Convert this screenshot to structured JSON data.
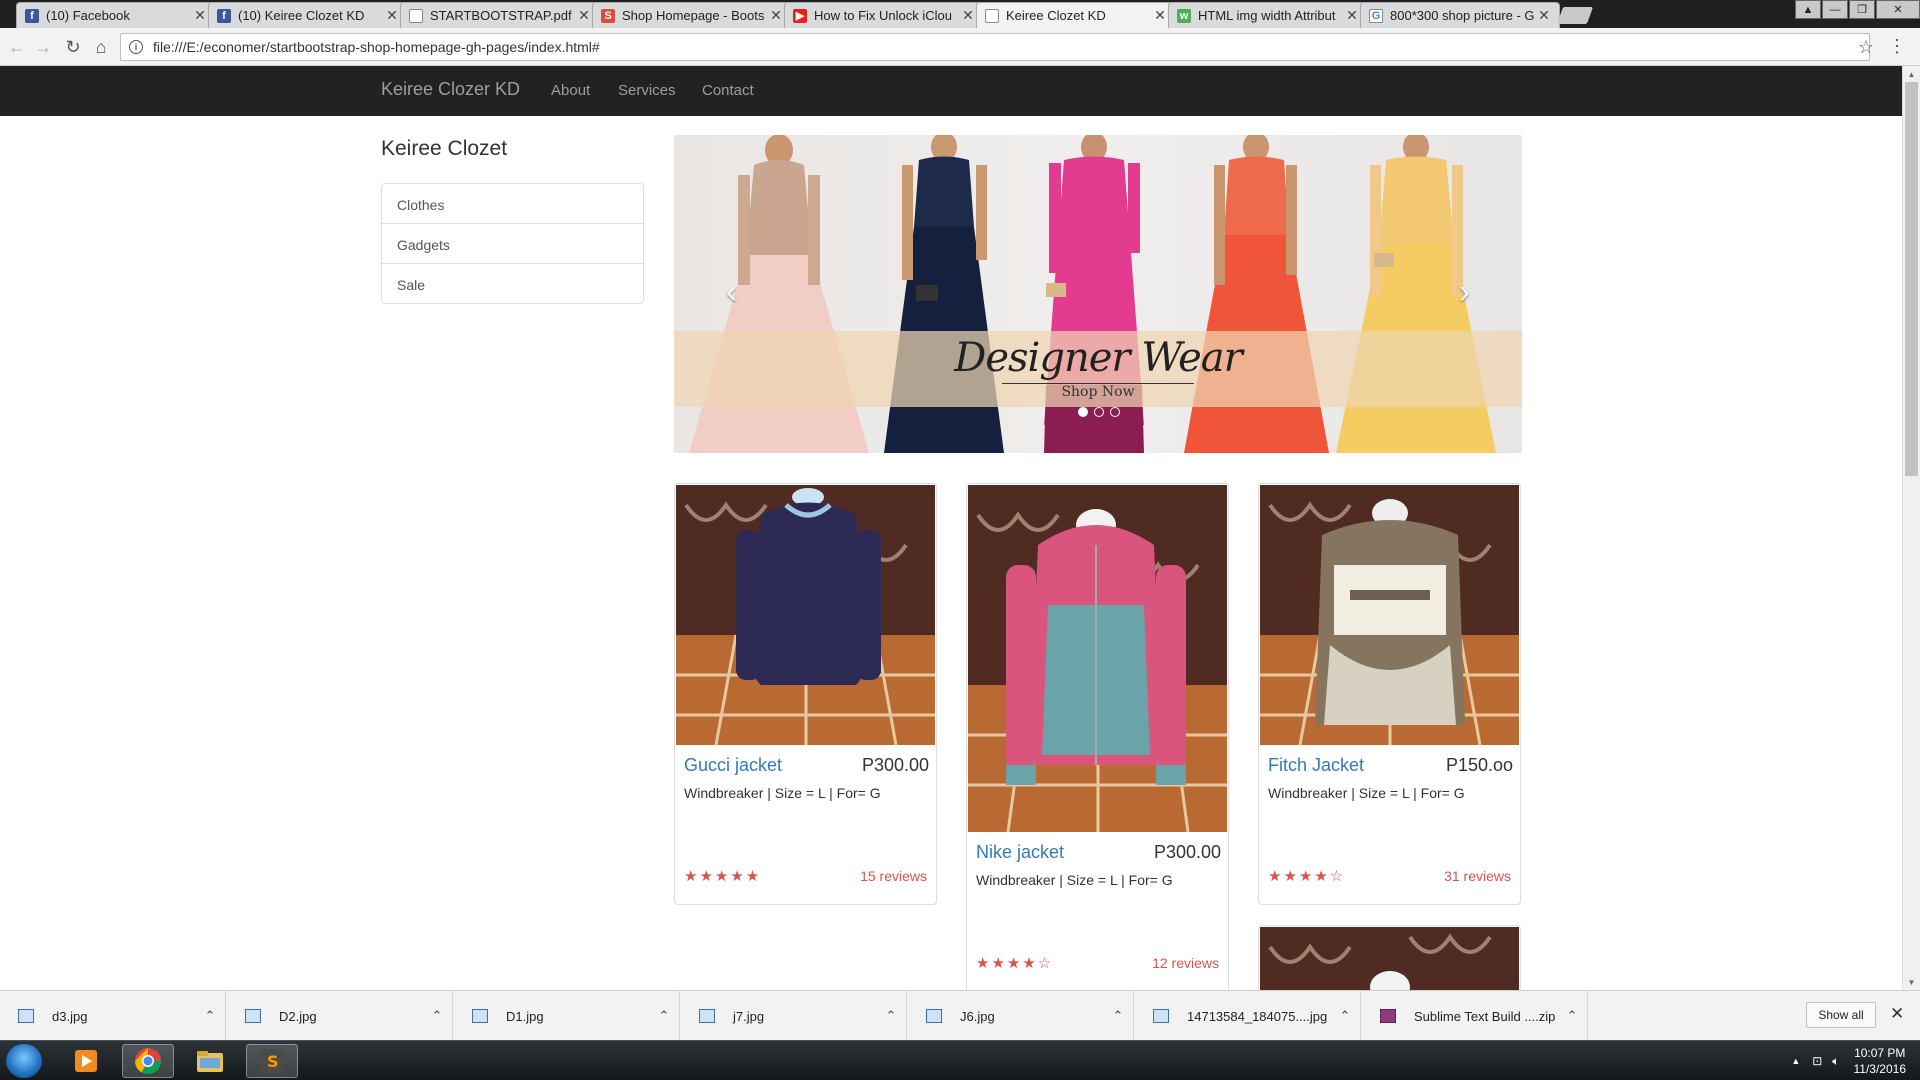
{
  "browser": {
    "tabs": [
      {
        "title": "(10) Facebook",
        "favicon": "facebook-icon",
        "color": "#3b5998",
        "glyph": "f",
        "active": false
      },
      {
        "title": "(10) Keiree Clozet KD",
        "favicon": "facebook-icon",
        "color": "#3b5998",
        "glyph": "f",
        "active": false
      },
      {
        "title": "STARTBOOTSTRAP.pdf",
        "favicon": "document-icon",
        "color": "#ffffff",
        "glyph": "",
        "active": false
      },
      {
        "title": "Shop Homepage - Boots",
        "favicon": "startbootstrap-icon",
        "color": "#dd4b39",
        "glyph": "S",
        "active": false
      },
      {
        "title": "How to Fix Unlock iClou",
        "favicon": "youtube-icon",
        "color": "#e62117",
        "glyph": "▶",
        "active": false
      },
      {
        "title": "Keiree Clozet KD",
        "favicon": "document-icon",
        "color": "#ffffff",
        "glyph": "",
        "active": true
      },
      {
        "title": "HTML img width Attribut",
        "favicon": "w3schools-icon",
        "color": "#4caf50",
        "glyph": "w",
        "active": false
      },
      {
        "title": "800*300 shop picture - G",
        "favicon": "google-icon",
        "color": "#ffffff",
        "glyph": "G",
        "active": false
      }
    ],
    "url": "file:///E:/economer/startbootstrap-shop-homepage-gh-pages/index.html#"
  },
  "navbar": {
    "brand": "Keiree Clozer KD",
    "links": [
      "About",
      "Services",
      "Contact"
    ]
  },
  "sidebar": {
    "heading": "Keiree Clozet",
    "items": [
      "Clothes",
      "Gadgets",
      "Sale"
    ]
  },
  "carousel": {
    "title": "Designer Wear",
    "subtitle": "Shop Now",
    "slides": 3,
    "active_slide": 0
  },
  "products": [
    {
      "name": "Gucci jacket",
      "price": "P300.00",
      "description": "Windbreaker | Size = L | For= G",
      "rating": 5,
      "reviews": "15 reviews"
    },
    {
      "name": "Nike jacket",
      "price": "P300.00",
      "description": "Windbreaker | Size = L | For= G",
      "rating": 4,
      "reviews": "12 reviews"
    },
    {
      "name": "Fitch Jacket",
      "price": "P150.oo",
      "description": "Windbreaker | Size = L | For= G",
      "rating": 4,
      "reviews": "31 reviews"
    }
  ],
  "downloads": {
    "items": [
      "d3.jpg",
      "D2.jpg",
      "D1.jpg",
      "j7.jpg",
      "J6.jpg",
      "14713584_184075....jpg",
      "Sublime Text Build ....zip"
    ],
    "show_all": "Show all"
  },
  "taskbar": {
    "apps": [
      "media-player-icon",
      "chrome-icon",
      "file-explorer-icon",
      "sublime-text-icon"
    ],
    "time": "10:07 PM",
    "date": "11/3/2016"
  }
}
